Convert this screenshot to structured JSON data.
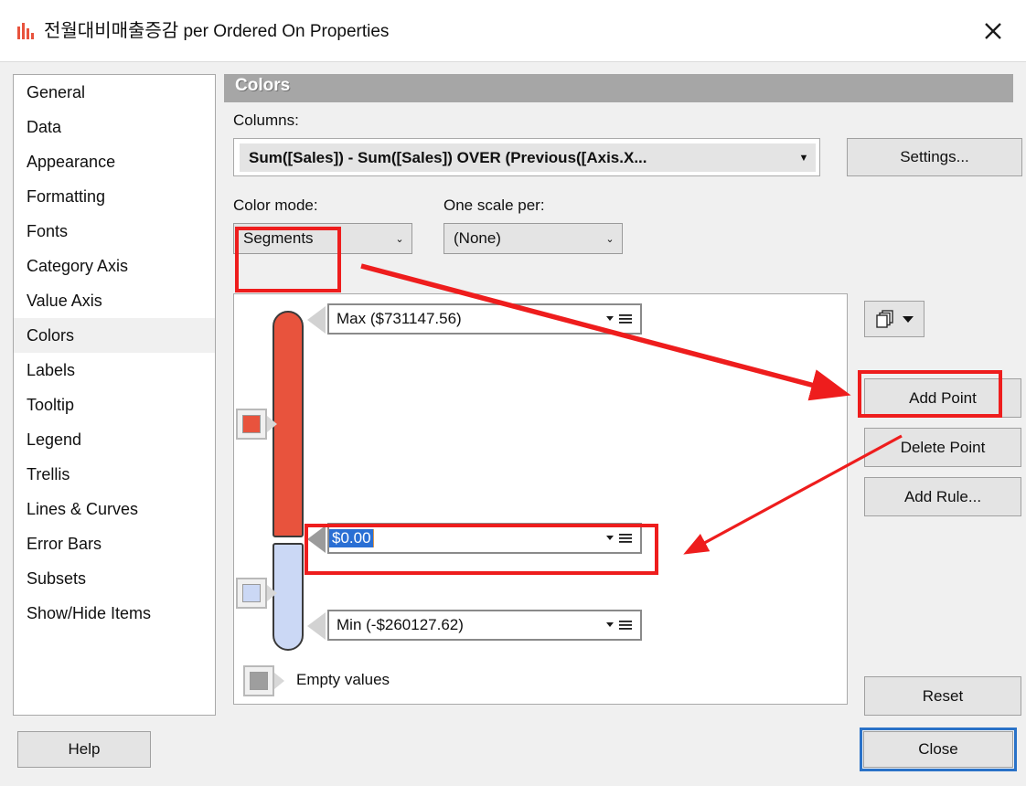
{
  "window": {
    "title_korean": "전월대비매출증감",
    "title_rest": " per Ordered On Properties",
    "icon": "bar-chart-icon",
    "close_label": "✕"
  },
  "sidebar": {
    "items": [
      {
        "label": "General",
        "selected": false
      },
      {
        "label": "Data",
        "selected": false
      },
      {
        "label": "Appearance",
        "selected": false
      },
      {
        "label": "Formatting",
        "selected": false
      },
      {
        "label": "Fonts",
        "selected": false
      },
      {
        "label": "Category Axis",
        "selected": false
      },
      {
        "label": "Value Axis",
        "selected": false
      },
      {
        "label": "Colors",
        "selected": true
      },
      {
        "label": "Labels",
        "selected": false
      },
      {
        "label": "Tooltip",
        "selected": false
      },
      {
        "label": "Legend",
        "selected": false
      },
      {
        "label": "Trellis",
        "selected": false
      },
      {
        "label": "Lines & Curves",
        "selected": false
      },
      {
        "label": "Error Bars",
        "selected": false
      },
      {
        "label": "Subsets",
        "selected": false
      },
      {
        "label": "Show/Hide Items",
        "selected": false
      }
    ]
  },
  "pane": {
    "header": "Colors",
    "columns_label": "Columns:",
    "columns_value": "Sum([Sales]) - Sum([Sales]) OVER (Previous([Axis.X...",
    "settings_button": "Settings...",
    "color_mode_label": "Color mode:",
    "color_mode_value": "Segments",
    "one_scale_label": "One scale per:",
    "one_scale_value": "(None)",
    "empty_values_label": "Empty values"
  },
  "scale": {
    "max_point": {
      "label": "Max ($731147.56)",
      "color": "#e8533d"
    },
    "mid_point": {
      "label": "$0.00",
      "selected": true,
      "color": "#cbd8f5"
    },
    "min_point": {
      "label": "Min (-$260127.62)",
      "color": "#cbd8f5"
    },
    "empty_color": "#9e9e9e",
    "segment_top_color": "#e8533d",
    "segment_bottom_color": "#cbd8f5"
  },
  "actions": {
    "duplicate_button": "duplicate-dropdown",
    "add_point": "Add Point",
    "delete_point": "Delete Point",
    "add_rule": "Add Rule...",
    "reset": "Reset"
  },
  "footer": {
    "help": "Help",
    "close": "Close"
  },
  "annotations": {
    "highlight_color": "#ee1d1d",
    "boxes": [
      "color-mode-highlight",
      "add-point-highlight",
      "mid-value-field-highlight"
    ],
    "arrows": [
      "color-mode-to-add-point",
      "delete-point-to-mid-value-field"
    ]
  }
}
